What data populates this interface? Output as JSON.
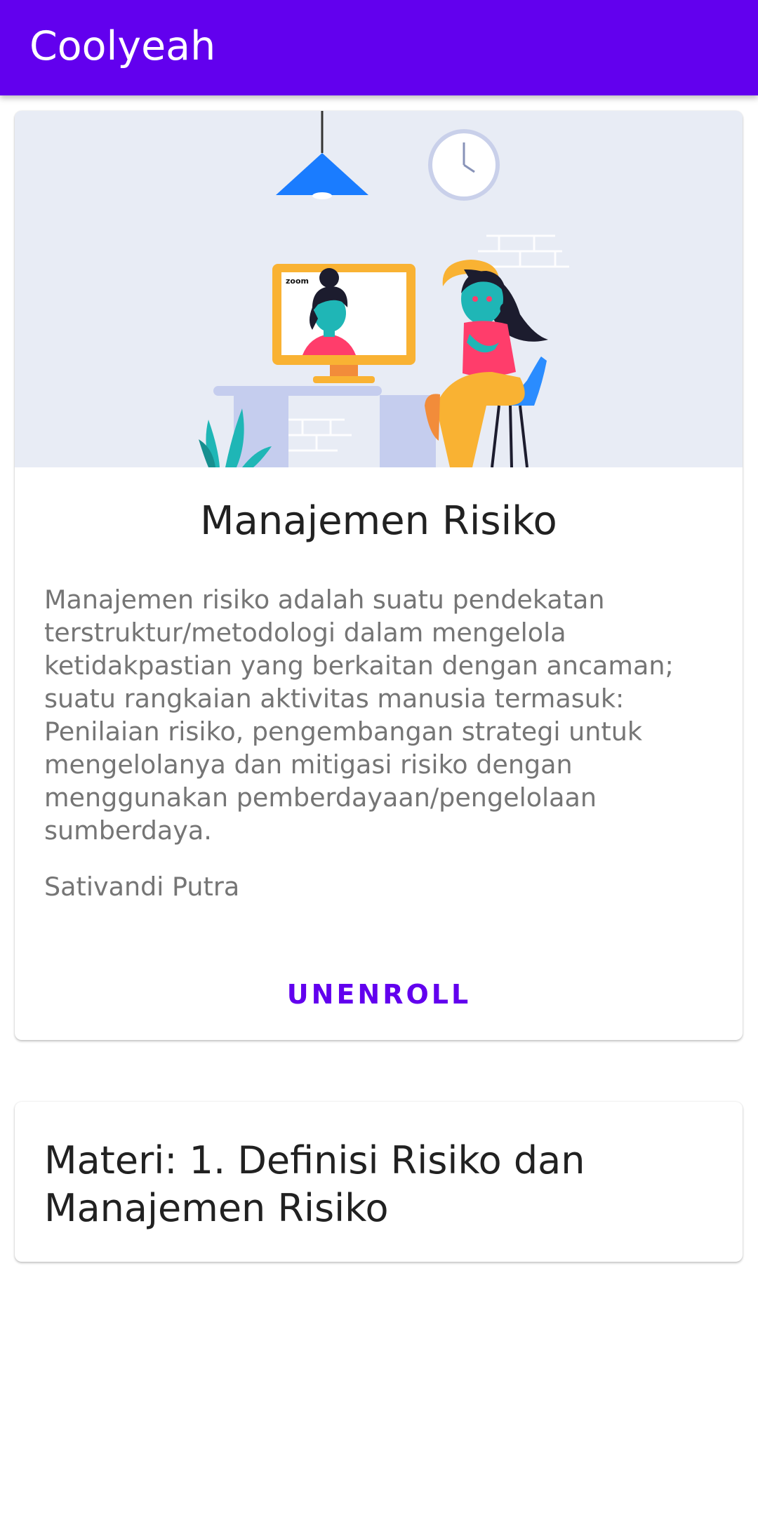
{
  "appbar": {
    "title": "Coolyeah"
  },
  "course": {
    "hero_screen_label": "zoom",
    "title": "Manajemen Risiko",
    "description": "Manajemen risiko adalah suatu pendekatan terstruktur/metodologi dalam mengelola ketidakpastian yang berkaitan dengan ancaman; suatu rangkaian aktivitas manusia termasuk: Penilaian risiko, pengembangan strategi untuk mengelolanya dan mitigasi risiko dengan menggunakan pemberdayaan/pengelolaan sumberdaya.",
    "author": "Sativandi Putra",
    "unenroll_label": "UNENROLL"
  },
  "materials": [
    {
      "title": "Materi: 1. Definisi Risiko dan Manajemen Risiko"
    }
  ],
  "colors": {
    "primary": "#6200ee",
    "hero_bg": "#e8ecf5"
  }
}
